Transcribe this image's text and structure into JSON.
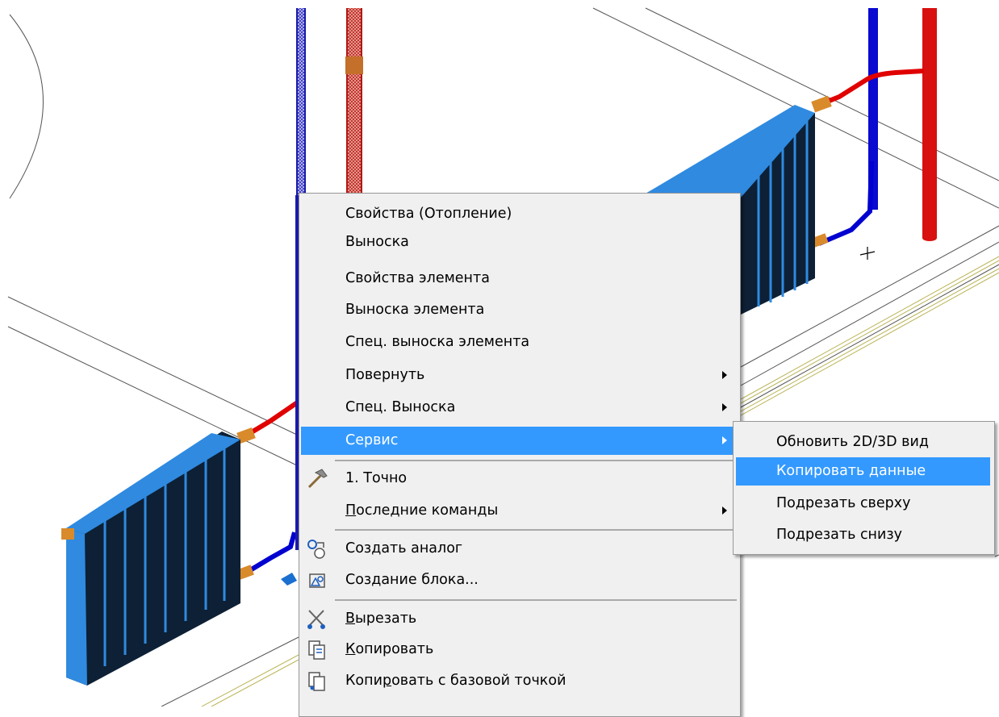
{
  "context_menu": {
    "items": [
      {
        "label": "Свойства (Отопление)"
      },
      {
        "label": "Выноска"
      },
      {
        "label": "Свойства элемента"
      },
      {
        "label": "Выноска элемента"
      },
      {
        "label": "Спец. выноска элемента"
      },
      {
        "label": "Повернуть",
        "has_submenu": true
      },
      {
        "label": "Спец. Выноска",
        "has_submenu": true
      },
      {
        "label": "Сервис",
        "has_submenu": true,
        "highlighted": true
      },
      {
        "label": "1. Точно",
        "icon": "hammer-icon"
      },
      {
        "label_pre": "",
        "label_key": "П",
        "label_post": "оследние команды",
        "has_submenu": true
      },
      {
        "label": "Создать аналог",
        "icon": "create-analog-icon"
      },
      {
        "label": "Создание блока...",
        "icon": "create-block-icon"
      },
      {
        "label_pre": "",
        "label_key": "В",
        "label_post": "ырезать",
        "icon": "scissors-icon"
      },
      {
        "label_pre": "",
        "label_key": "К",
        "label_post": "опировать",
        "icon": "copy-icon"
      },
      {
        "label_pre": "Копи",
        "label_key": "р",
        "label_post": "овать с базовой точкой",
        "icon": "copy-base-point-icon"
      }
    ]
  },
  "submenu": {
    "items": [
      {
        "label": "Обновить 2D/3D вид"
      },
      {
        "label": "Копировать данные",
        "highlighted": true
      },
      {
        "label": "Подрезать сверху"
      },
      {
        "label": "Подрезать снизу"
      }
    ]
  },
  "colors": {
    "highlight": "#3399ff",
    "menu_bg": "#f0f0f0",
    "radiator_front": "#0d2035",
    "radiator_top": "#2f8ae0",
    "supply_pipe": "#e00000",
    "return_pipe": "#0000cc",
    "valve": "#d98a2b"
  }
}
